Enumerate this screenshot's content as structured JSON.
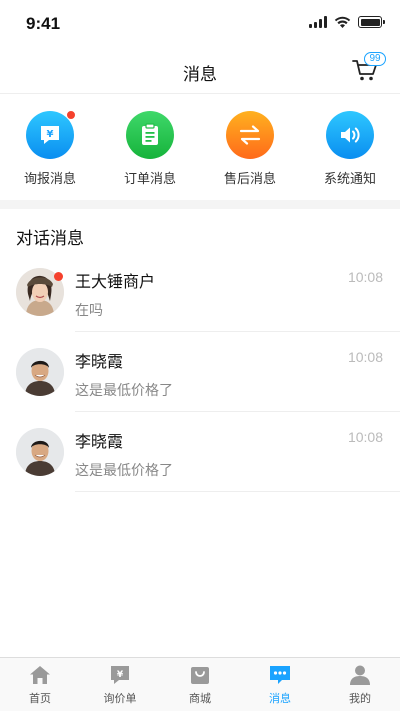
{
  "status": {
    "time": "9:41"
  },
  "header": {
    "title": "消息",
    "cart_badge": "99"
  },
  "categories": [
    {
      "label": "询报消息",
      "icon": "quote-message-icon",
      "color_top": "#2ec7ff",
      "color_bottom": "#0a8ef0",
      "has_dot": true
    },
    {
      "label": "订单消息",
      "icon": "order-clipboard-icon",
      "color_top": "#3fd86a",
      "color_bottom": "#16b33b",
      "has_dot": false
    },
    {
      "label": "售后消息",
      "icon": "exchange-arrows-icon",
      "color_top": "#ffb11f",
      "color_bottom": "#ff6a1a",
      "has_dot": false
    },
    {
      "label": "系统通知",
      "icon": "speaker-icon",
      "color_top": "#2ec7ff",
      "color_bottom": "#0a8ef0",
      "has_dot": false
    }
  ],
  "section_title": "对话消息",
  "conversations": [
    {
      "name": "王大锤商户",
      "time": "10:08",
      "message": "在吗",
      "unread": true
    },
    {
      "name": "李晓霞",
      "time": "10:08",
      "message": "这是最低价格了",
      "unread": false
    },
    {
      "name": "李晓霞",
      "time": "10:08",
      "message": "这是最低价格了",
      "unread": false
    }
  ],
  "tabs": [
    {
      "label": "首页",
      "icon": "home-icon",
      "active": false
    },
    {
      "label": "询价单",
      "icon": "price-list-icon",
      "active": false
    },
    {
      "label": "商城",
      "icon": "shopping-bag-icon",
      "active": false
    },
    {
      "label": "消息",
      "icon": "chat-bubble-icon",
      "active": true
    },
    {
      "label": "我的",
      "icon": "user-icon",
      "active": false
    }
  ],
  "colors": {
    "accent": "#1aa3ff",
    "badge_red": "#f5412d",
    "inactive_icon": "#9a9a9a"
  }
}
